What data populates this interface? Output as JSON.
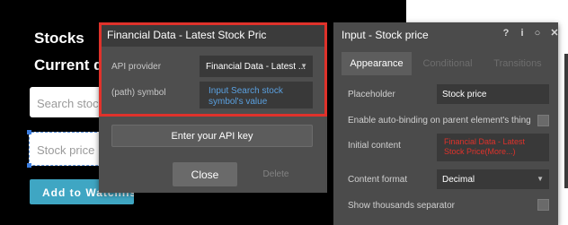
{
  "canvas": {
    "heading_1": "Stocks",
    "heading_2": "Current d",
    "search_placeholder": "Search stock",
    "stock_placeholder": "Stock price",
    "watchlist_button": "Add to Watchlist"
  },
  "data_popup": {
    "title": "Financial Data - Latest Stock Pric",
    "api_provider_label": "API provider",
    "api_provider_value": "Financial Data - Latest ...",
    "symbol_label": "(path) symbol",
    "symbol_value": "Input Search stock symbol's value",
    "api_key_button": "Enter your API key",
    "close_button": "Close",
    "delete_button": "Delete"
  },
  "property_editor": {
    "title": "Input - Stock price",
    "tabs": [
      {
        "label": "Appearance",
        "active": true
      },
      {
        "label": "Conditional",
        "active": false
      },
      {
        "label": "Transitions",
        "active": false
      }
    ],
    "placeholder_label": "Placeholder",
    "placeholder_value": "Stock price",
    "auto_binding_label": "Enable auto-binding on parent element's thing",
    "initial_content_label": "Initial content",
    "initial_content_value": "Financial Data - Latest Stock Price(More...)",
    "content_format_label": "Content format",
    "content_format_value": "Decimal",
    "thousands_label": "Show thousands separator",
    "header_icons": [
      "question-icon",
      "info-icon",
      "comment-icon",
      "close-icon"
    ]
  },
  "colors": {
    "highlight": "#e0322b",
    "button_teal": "#3fa6c3",
    "link_blue": "#5aa0e0"
  }
}
